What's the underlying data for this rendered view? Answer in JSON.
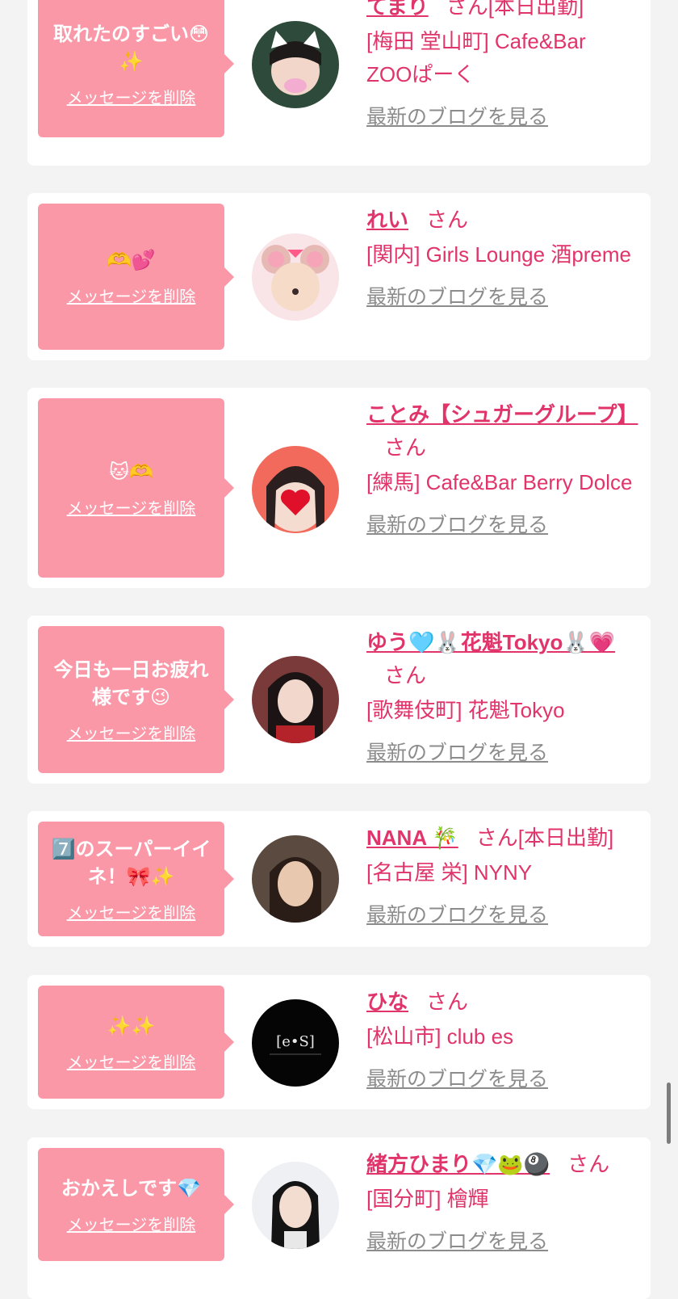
{
  "delete_label": "メッセージを削除",
  "blog_label": "最新のブログを見る",
  "san_label": "さん",
  "colors": {
    "accent": "#e0346a",
    "bubble": "#fa98a8",
    "link_gray": "#8c8c8c",
    "background": "#f3f3f3"
  },
  "items": [
    {
      "message": "取れたのすごい😳✨",
      "name": "てまり",
      "today": "[本日出勤]",
      "shop": "[梅田 堂山町] Cafe&Bar ZOOぱーく",
      "avatar": "cat-ears-girl"
    },
    {
      "message": "🫶💕",
      "name": "れい",
      "today": "",
      "shop": "[関内] Girls Lounge 酒preme",
      "avatar": "mouse-filter-girl"
    },
    {
      "message": "🐱🫶",
      "name": "ことみ【シュガーグループ】",
      "today": "",
      "shop": "[練馬] Cafe&Bar Berry Dolce",
      "avatar": "heart-sticker-girl"
    },
    {
      "message": "今日も一日お疲れ様です😉",
      "name": "ゆう🩵🐰花魁Tokyo🐰💗",
      "today": "",
      "shop": "[歌舞伎町] 花魁Tokyo",
      "avatar": "dark-hair-girl"
    },
    {
      "message": "7️⃣のスーパーイイネ！🎀✨",
      "name": "NANA 🎋",
      "today": "[本日出勤]",
      "shop": "[名古屋 栄] NYNY",
      "avatar": "long-hair-girl"
    },
    {
      "message": "✨✨",
      "name": "ひな",
      "today": "",
      "shop": "[松山市] club es",
      "avatar": "club-es-logo"
    },
    {
      "message": "おかえしです💎",
      "name": "緒方ひまり💎🐸🎱",
      "today": "",
      "shop": "[国分町] 檜輝",
      "avatar": "black-hair-girl"
    }
  ]
}
